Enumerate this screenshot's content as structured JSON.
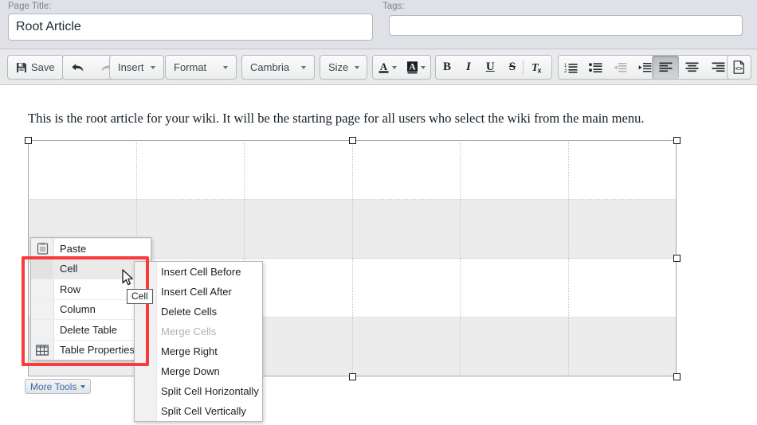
{
  "header": {
    "page_title_label": "Page Title:",
    "page_title_value": "Root Article",
    "tags_label": "Tags:",
    "tags_value": "",
    "tags_placeholder": ""
  },
  "toolbar": {
    "save_label": "Save",
    "save_icon": "floppy-disk-icon",
    "undo_icon": "undo-arrow-icon",
    "redo_icon": "redo-arrow-icon",
    "redo_disabled": true,
    "insert_label": "Insert",
    "format_label": "Format",
    "font_label": "Cambria",
    "size_label": "Size",
    "text_color_icon": "text-color-icon",
    "highlight_color_icon": "highlight-color-icon",
    "bold_label": "B",
    "italic_label": "I",
    "underline_label": "U",
    "strikethrough_label": "S",
    "clear_format_label": "Tx",
    "numbered_list_icon": "numbered-list-icon",
    "bullet_list_icon": "bullet-list-icon",
    "outdent_icon": "outdent-icon",
    "outdent_disabled": true,
    "indent_icon": "indent-icon",
    "align_left_icon": "align-left-icon",
    "align_left_active": true,
    "align_center_icon": "align-center-icon",
    "align_right_icon": "align-right-icon",
    "source_code_icon": "source-code-icon"
  },
  "editor": {
    "body_text": "This is the root article for your wiki. It will be the starting page for all users who select the wiki from the main menu.",
    "more_tools_label": "More Tools",
    "table": {
      "columns": 6,
      "rows": 4,
      "row_shading": [
        "plain",
        "shaded",
        "plain",
        "shaded"
      ],
      "selected": true
    }
  },
  "context_menu": {
    "items": [
      {
        "label": "Paste",
        "icon": "clipboard-icon",
        "submenu": false,
        "highlighted": false,
        "disabled": false
      },
      {
        "label": "Cell",
        "icon": "",
        "submenu": true,
        "highlighted": true,
        "disabled": false
      },
      {
        "label": "Row",
        "icon": "",
        "submenu": false,
        "highlighted": false,
        "disabled": false
      },
      {
        "label": "Column",
        "icon": "",
        "submenu": true,
        "highlighted": false,
        "disabled": false
      },
      {
        "label": "Delete Table",
        "icon": "",
        "submenu": false,
        "highlighted": false,
        "disabled": false
      },
      {
        "label": "Table Properties",
        "icon": "table-grid-icon",
        "submenu": false,
        "highlighted": false,
        "disabled": false
      }
    ]
  },
  "submenu": {
    "items": [
      {
        "label": "Insert Cell Before",
        "disabled": false
      },
      {
        "label": "Insert Cell After",
        "disabled": false
      },
      {
        "label": "Delete Cells",
        "disabled": false
      },
      {
        "label": "Merge Cells",
        "disabled": true
      },
      {
        "label": "Merge Right",
        "disabled": false
      },
      {
        "label": "Merge Down",
        "disabled": false
      },
      {
        "label": "Split Cell Horizontally",
        "disabled": false
      },
      {
        "label": "Split Cell Vertically",
        "disabled": false
      }
    ]
  },
  "tooltip": {
    "text": "Cell"
  },
  "annotation": {
    "highlight_color": "#fb3b3b"
  },
  "colors": {
    "header_bg": "#dfe1e6",
    "toolbar_bg": "#e8e9eb",
    "canvas_bg": "#ffffff",
    "table_shaded_row": "#ececec",
    "menu_bg": "#ffffff",
    "menu_gutter": "#f1f1f1",
    "link_blue": "#3b6ea5"
  }
}
